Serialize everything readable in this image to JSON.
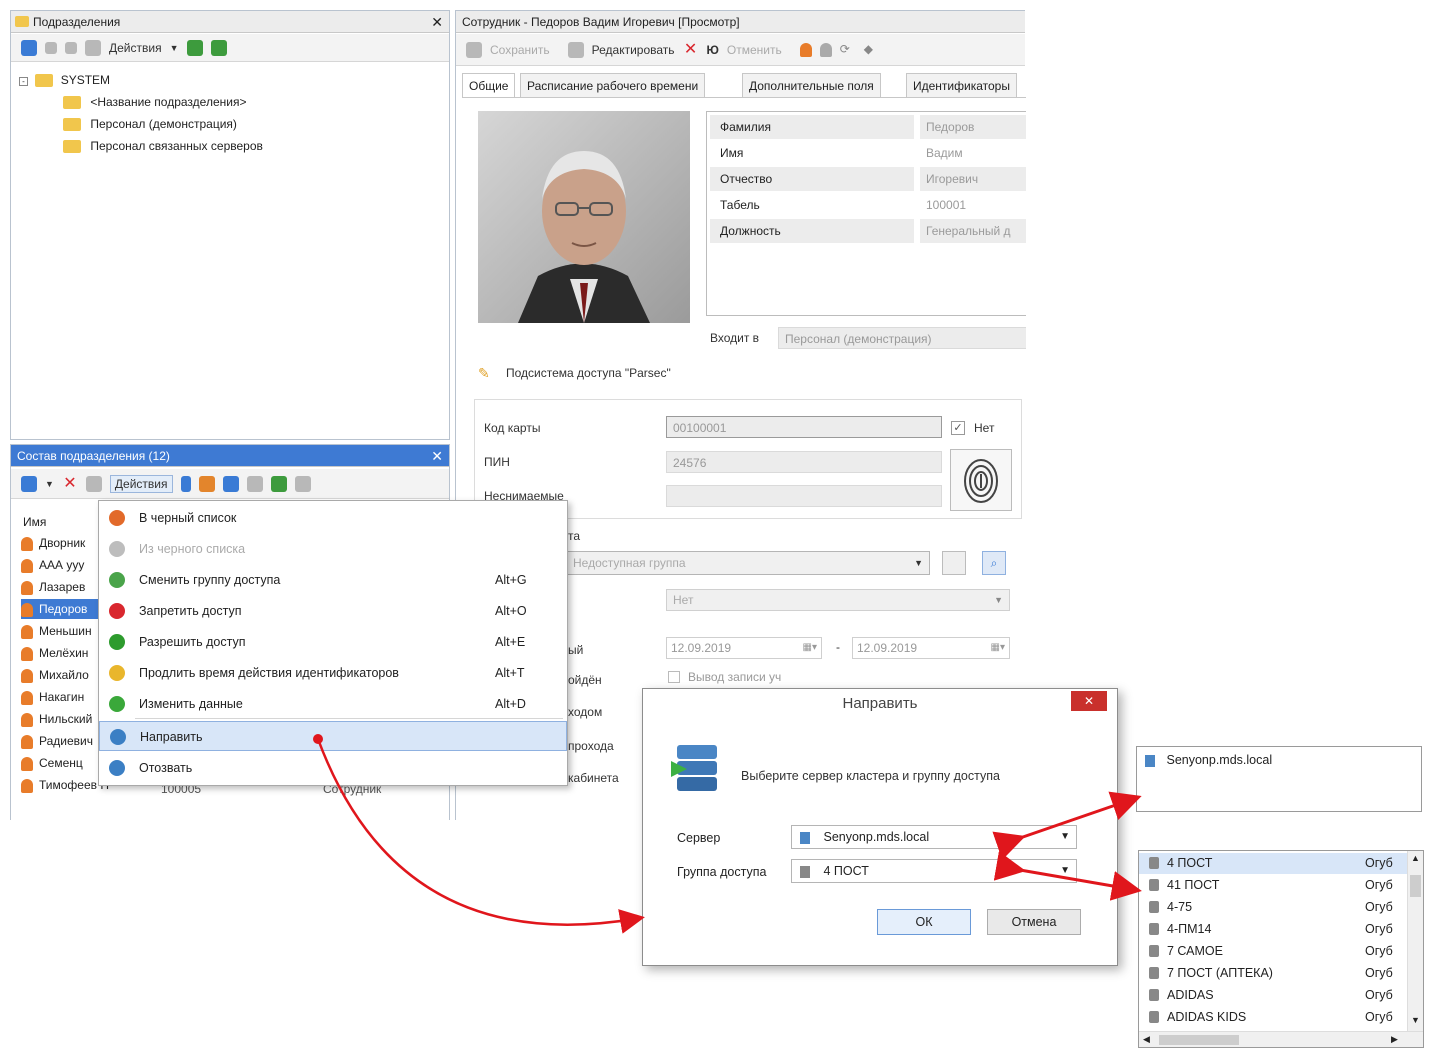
{
  "left_top_panel": {
    "title": "Подразделения",
    "toolbar_actions": "Действия",
    "tree": {
      "root": "SYSTEM",
      "items": [
        "<Название подразделения>",
        "Персонал (демонстрация)",
        "Персонал связанных серверов"
      ]
    }
  },
  "left_bottom_panel": {
    "title": "Состав подразделения (12)",
    "toolbar_actions": "Действия",
    "column_name": "Имя",
    "rows": [
      "Дворник",
      "ААА ууу",
      "Лазарев",
      "Педоров",
      "Меньшин",
      "Мелёхин",
      "Михайло",
      "Накагин",
      "Нильский",
      "Радиевич",
      "Семенц",
      "Тимофеев П"
    ],
    "last_row_extra": [
      "100005",
      "Сотрудник"
    ]
  },
  "context_menu": {
    "items": [
      {
        "label": "В черный список",
        "key": "",
        "icon": "person-blacklist-icon",
        "color": "#e26a2a",
        "disabled": false
      },
      {
        "label": "Из черного списка",
        "key": "",
        "icon": "person-unblacklist-icon",
        "color": "#bdbdbd",
        "disabled": true
      },
      {
        "label": "Сменить группу доступа",
        "key": "Alt+G",
        "icon": "change-group-icon",
        "color": "#4aa44a",
        "disabled": false
      },
      {
        "label": "Запретить доступ",
        "key": "Alt+O",
        "icon": "deny-access-icon",
        "color": "#d9272e",
        "disabled": false
      },
      {
        "label": "Разрешить доступ",
        "key": "Alt+E",
        "icon": "allow-access-icon",
        "color": "#2d9b2d",
        "disabled": false
      },
      {
        "label": "Продлить время действия идентификаторов",
        "key": "Alt+T",
        "icon": "extend-time-icon",
        "color": "#e9b62c",
        "disabled": false
      },
      {
        "label": "Изменить данные",
        "key": "Alt+D",
        "icon": "edit-data-icon",
        "color": "#3aa83a",
        "disabled": false
      },
      {
        "label": "Направить",
        "key": "",
        "icon": "send-icon",
        "color": "#3b7fc4",
        "disabled": false,
        "selected": true
      },
      {
        "label": "Отозвать",
        "key": "",
        "icon": "recall-icon",
        "color": "#3b7fc4",
        "disabled": false
      }
    ]
  },
  "employee_window": {
    "title": "Сотрудник - Педоров Вадим Игоревич [Просмотр]",
    "toolbar": {
      "save": "Сохранить",
      "edit": "Редактировать",
      "cancel": "Отменить"
    },
    "tabs": [
      "Общие",
      "Расписание рабочего времени",
      "Дополнительные поля",
      "Идентификаторы"
    ],
    "fields": [
      {
        "label": "Фамилия",
        "value": "Педоров"
      },
      {
        "label": "Имя",
        "value": "Вадим"
      },
      {
        "label": "Отчество",
        "value": "Игоревич"
      },
      {
        "label": "Табель",
        "value": "100001"
      },
      {
        "label": "Должность",
        "value": "Генеральный д"
      }
    ],
    "member_of_label": "Входит в",
    "member_of_value": "Персонал (демонстрация)",
    "subsystem_title": "Подсистема доступа \"Parsec\"",
    "card_code_label": "Код карты",
    "card_code_value": "00100001",
    "no_label": "Нет",
    "pin_label": "ПИН",
    "pin_value": "24576",
    "fragment_label": "Неснимаемые",
    "group_fragment": "та",
    "group_placeholder": "Недоступная группа",
    "second_select": "Нет",
    "date_from": "12.09.2019",
    "date_sep": "-",
    "date_to": "12.09.2019",
    "checkbox_label": "Вывод записи уч",
    "side_fragments": [
      "ый",
      "ойдён",
      "ходом",
      "прохода",
      "кабинета"
    ]
  },
  "dialog": {
    "title": "Направить",
    "message": "Выберите сервер кластера и группу доступа",
    "server_label": "Сервер",
    "server_value": "Senyonp.mds.local",
    "group_label": "Группа доступа",
    "group_value": "4 ПОСТ",
    "ok": "ОК",
    "cancel": "Отмена"
  },
  "server_popup": {
    "items": [
      "Senyonp.mds.local"
    ]
  },
  "group_popup": {
    "items": [
      {
        "name": "4 ПОСТ",
        "value": "Огуб"
      },
      {
        "name": "41 ПОСТ",
        "value": "Огуб"
      },
      {
        "name": "4-75",
        "value": "Огуб"
      },
      {
        "name": "4-ПМ14",
        "value": "Огуб"
      },
      {
        "name": "7 САМОЕ",
        "value": "Огуб"
      },
      {
        "name": "7 ПОСТ (АПТЕКА)",
        "value": "Огуб"
      },
      {
        "name": "ADIDAS",
        "value": "Огуб"
      },
      {
        "name": "ADIDAS KIDS",
        "value": "Огуб"
      }
    ]
  },
  "colors": {
    "accent_blue": "#3e7ad3",
    "arrow_red": "#e0161c",
    "selection": "#d8e6f8"
  }
}
